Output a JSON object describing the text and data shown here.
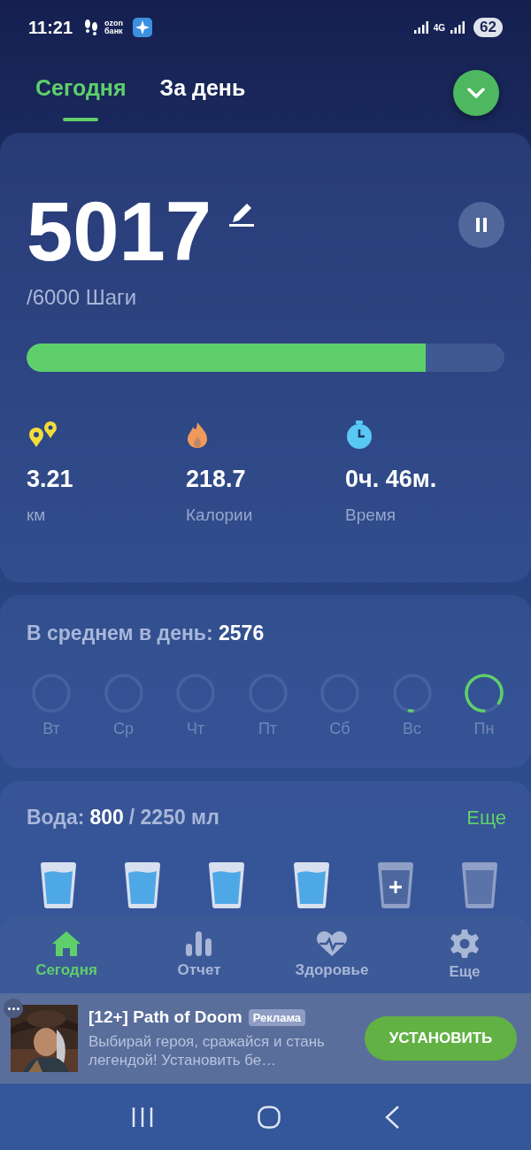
{
  "status_bar": {
    "time": "11:21",
    "notification_label": "ozon банк",
    "network": "4G",
    "battery": "62"
  },
  "tabs": [
    {
      "label": "Сегодня",
      "selected": true
    },
    {
      "label": "За день",
      "selected": false
    }
  ],
  "steps": {
    "count": "5017",
    "goal": "/6000 Шаги",
    "level": 0.836,
    "paused": false
  },
  "stats": [
    {
      "kind": "distance",
      "value": "3.21",
      "unit": "км"
    },
    {
      "kind": "calories",
      "value": "218.7",
      "unit": "Калории"
    },
    {
      "kind": "time",
      "value": "0ч. 46м.",
      "unit": "Время"
    }
  ],
  "average": {
    "label": "В среднем в день:",
    "value": "2576"
  },
  "week": [
    {
      "day": "Вт"
    },
    {
      "day": "Ср"
    },
    {
      "day": "Чт"
    },
    {
      "day": "Пт"
    },
    {
      "day": "Сб"
    },
    {
      "day": "Вс"
    },
    {
      "day": "Пн"
    }
  ],
  "water": {
    "label": "Вода:",
    "amount": "800",
    "goal": "/ 2250 мл",
    "more": "Еще",
    "glasses": [
      {
        "kind": "full"
      },
      {
        "kind": "full"
      },
      {
        "kind": "full"
      },
      {
        "kind": "full"
      },
      {
        "kind": "add"
      },
      {
        "kind": "empty"
      }
    ]
  },
  "bottom_nav": [
    {
      "kind": "home",
      "label": "Сегодня",
      "selected": true
    },
    {
      "kind": "report",
      "label": "Отчет",
      "selected": false
    },
    {
      "kind": "health",
      "label": "Здоровье",
      "selected": false
    },
    {
      "kind": "settings",
      "label": "Еще",
      "selected": false
    }
  ],
  "ad": {
    "kind": "picture",
    "title": "[12+] Path of Doom",
    "badge": "Реклама",
    "text": "Выбирай героя, сражайся и стань легендой! Установить бе…",
    "button": "УСТАНОВИТЬ"
  }
}
